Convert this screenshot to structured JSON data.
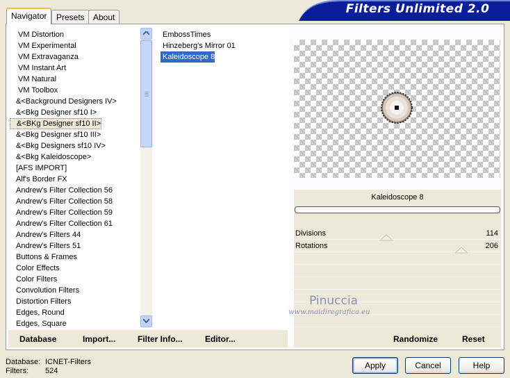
{
  "tabs": [
    {
      "label": "Navigator",
      "active": true
    },
    {
      "label": "Presets",
      "active": false
    },
    {
      "label": "About",
      "active": false
    }
  ],
  "title": "Filters Unlimited 2.0",
  "categories": [
    "VM Distortion",
    "VM Experimental",
    "VM Extravaganza",
    "VM Instant Art",
    "VM Natural",
    "VM Toolbox",
    "&<Background Designers IV>",
    "&<Bkg Designer sf10 I>",
    "&<BKg Designer sf10 II>",
    "&<Bkg Designer sf10 III>",
    "&<Bkg Designers sf10 IV>",
    "&<Bkg Kaleidoscope>",
    "[AFS IMPORT]",
    "Alf's Border FX",
    "Andrew's Filter Collection 56",
    "Andrew's Filter Collection 58",
    "Andrew's Filter Collection 59",
    "Andrew's Filter Collection 61",
    "Andrew's Filters 44",
    "Andrew's Filters 51",
    "Buttons & Frames",
    "Color Effects",
    "Color Filters",
    "Convolution Filters",
    "Distortion Filters",
    "Edges, Round",
    "Edges, Square"
  ],
  "selected_category_index": 8,
  "filters": [
    "EmbossTimes",
    "Hinzeberg's Mirror 01",
    "Kaleidoscope 8"
  ],
  "selected_filter_index": 2,
  "filter_name": "Kaleidoscope 8",
  "params": [
    {
      "label": "Divisions",
      "value": "114"
    },
    {
      "label": "Rotations",
      "value": "206"
    }
  ],
  "left_buttons": {
    "database": "Database",
    "import": "Import...",
    "filter_info": "Filter Info...",
    "editor": "Editor..."
  },
  "right_buttons": {
    "randomize": "Randomize",
    "reset": "Reset"
  },
  "watermark": {
    "name": "Pinuccia",
    "url": "www.maidiregrafica.eu"
  },
  "status": {
    "database_label": "Database:",
    "database_value": "ICNET-Filters",
    "filters_label": "Filters:",
    "filters_value": "524"
  },
  "dialog_buttons": {
    "apply": "Apply",
    "cancel": "Cancel",
    "help": "Help"
  },
  "colors": {
    "selection": "#316ac5",
    "banner": "#0a1e9c",
    "tab_highlight": "#f6b736"
  }
}
